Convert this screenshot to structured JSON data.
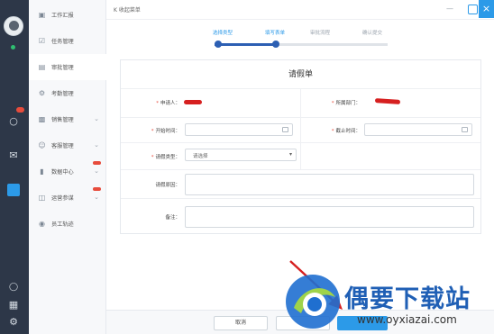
{
  "sidebar": {
    "items": [
      {
        "label": "工作汇报",
        "icon": "report-icon"
      },
      {
        "label": "任务管理",
        "icon": "task-icon"
      },
      {
        "label": "审批管理",
        "icon": "approval-icon"
      },
      {
        "label": "考勤管理",
        "icon": "attendance-icon"
      },
      {
        "label": "销售管理",
        "icon": "sales-icon"
      },
      {
        "label": "客服管理",
        "icon": "customer-service-icon"
      },
      {
        "label": "数据中心",
        "icon": "data-center-icon"
      },
      {
        "label": "运营参谋",
        "icon": "operations-icon"
      },
      {
        "label": "员工轨迹",
        "icon": "employee-track-icon"
      }
    ]
  },
  "header": {
    "back": "K",
    "title": "收起菜单"
  },
  "steps": [
    {
      "label": "选择类型",
      "done": true
    },
    {
      "label": "填写表单",
      "done": true
    },
    {
      "label": "审批流程",
      "done": false
    },
    {
      "label": "确认提交",
      "done": false
    }
  ],
  "form": {
    "title": "请假单",
    "applicant_label": "申请人：",
    "department_label": "所属部门：",
    "start_label": "开始时间：",
    "end_label": "截止时间：",
    "type_label": "请假类型：",
    "type_value": "请选择",
    "reason_label": "请假原因：",
    "remark_label": "备注："
  },
  "footer": {
    "cancel": "取消",
    "prev": "",
    "submit": ""
  },
  "watermark": {
    "title": "偶要下载站",
    "url": "www.oyxiazai.com"
  },
  "colors": {
    "accent": "#2c9ae8",
    "step_done": "#2c5fb3",
    "redaction": "#d62020",
    "rail": "#2d3748"
  }
}
